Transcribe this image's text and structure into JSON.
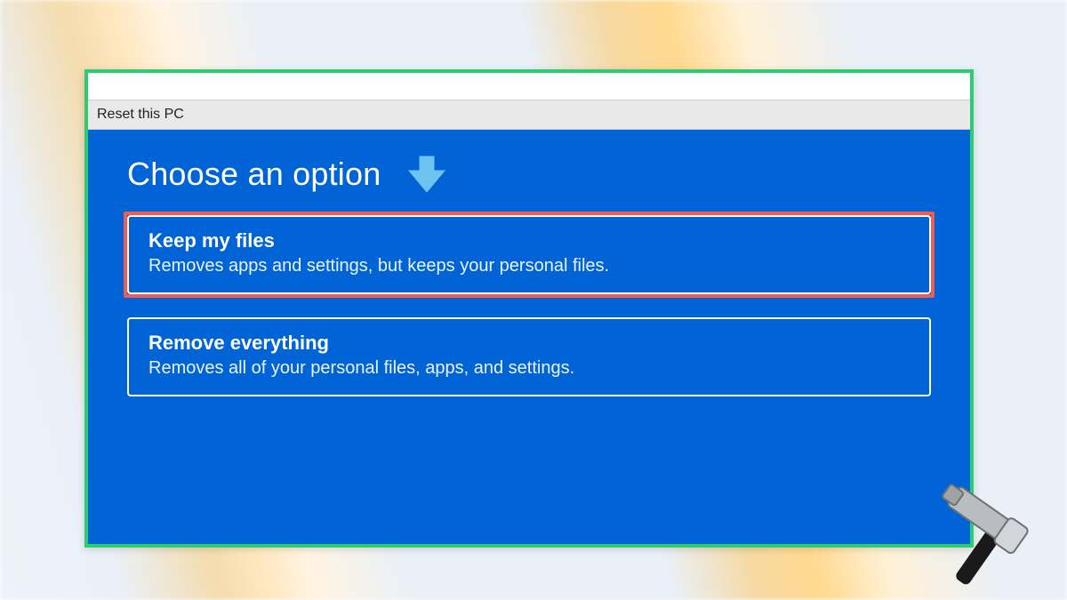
{
  "window": {
    "title": "Reset this PC"
  },
  "page": {
    "heading": "Choose an option"
  },
  "options": {
    "keep": {
      "title": "Keep my files",
      "desc": "Removes apps and settings, but keeps your personal files."
    },
    "remove": {
      "title": "Remove everything",
      "desc": "Removes all of your personal files, apps, and settings."
    }
  },
  "annotations": {
    "frame_color": "#2ecc71",
    "highlight_color": "#f25b52",
    "highlighted_option": "keep",
    "watermark": "hammer-icon"
  }
}
